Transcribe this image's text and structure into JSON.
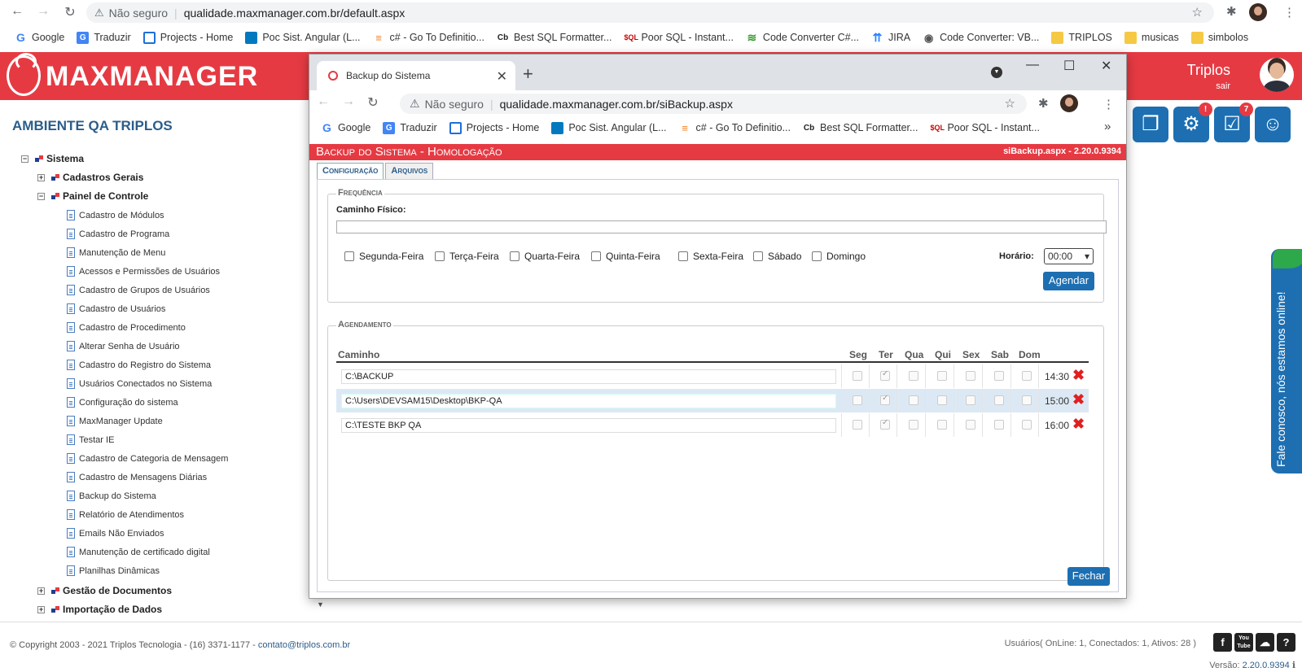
{
  "outer_browser": {
    "security_label": "Não seguro",
    "url": "qualidade.maxmanager.com.br/default.aspx",
    "bookmarks": [
      {
        "label": "Google",
        "icon": "google-icon"
      },
      {
        "label": "Traduzir",
        "icon": "translate-icon"
      },
      {
        "label": "Projects - Home",
        "icon": "projects-icon"
      },
      {
        "label": "Poc Sist. Angular (L...",
        "icon": "trello-icon"
      },
      {
        "label": "c# - Go To Definitio...",
        "icon": "stackoverflow-icon"
      },
      {
        "label": "Best SQL Formatter...",
        "icon": "cb-icon"
      },
      {
        "label": "Poor SQL - Instant...",
        "icon": "sql-icon"
      },
      {
        "label": "Code Converter C#...",
        "icon": "code-converter-icon"
      },
      {
        "label": "JIRA",
        "icon": "jira-icon"
      },
      {
        "label": "Code Converter: VB...",
        "icon": "globe-icon"
      },
      {
        "label": "TRIPLOS",
        "icon": "folder-icon"
      },
      {
        "label": "musicas",
        "icon": "folder-icon"
      },
      {
        "label": "simbolos",
        "icon": "folder-icon"
      }
    ]
  },
  "app": {
    "logo_text": "MAXMANAGER",
    "user_name": "Triplos",
    "logout": "sair",
    "environment": "AMBIENTE QA TRIPLOS",
    "badges": {
      "settings": "!",
      "tasks": "7"
    }
  },
  "tree": {
    "root": "Sistema",
    "groups": [
      {
        "label": "Cadastros Gerais",
        "expanded": false
      },
      {
        "label": "Painel de Controle",
        "expanded": true
      }
    ],
    "items": [
      "Cadastro de Módulos",
      "Cadastro de Programa",
      "Manutenção de Menu",
      "Acessos e Permissões de Usuários",
      "Cadastro de Grupos de Usuários",
      "Cadastro de Usuários",
      "Cadastro de Procedimento",
      "Alterar Senha de Usuário",
      "Cadastro do Registro do Sistema",
      "Usuários Conectados no Sistema",
      "Configuração do sistema",
      "MaxManager Update",
      "Testar IE",
      "Cadastro de Categoria de Mensagem",
      "Cadastro de Mensagens Diárias",
      "Backup do Sistema",
      "Relatório de Atendimentos",
      "Emails Não Enviados",
      "Manutenção de certificado digital",
      "Planilhas Dinâmicas"
    ],
    "after_groups": [
      "Gestão de Documentos",
      "Importação de Dados"
    ]
  },
  "footer": {
    "copyright": "© Copyright 2003 - 2021 Triplos Tecnologia - (16) 3371-1177 - ",
    "email": "contato@triplos.com.br",
    "users": "Usuários( OnLine: 1, Conectados: 1, Ativos: 28 )",
    "version_label": "Versão: ",
    "version": "2.20.0.9394",
    "social": [
      "f",
      "You Tube",
      "☁",
      "?"
    ]
  },
  "chat_tab": "Fale conosco, nós estamos online!",
  "popup": {
    "tab_title": "Backup do Sistema",
    "security_label": "Não seguro",
    "url": "qualidade.maxmanager.com.br/siBackup.aspx",
    "bookmarks": [
      {
        "label": "Google",
        "icon": "google-icon"
      },
      {
        "label": "Traduzir",
        "icon": "translate-icon"
      },
      {
        "label": "Projects - Home",
        "icon": "projects-icon"
      },
      {
        "label": "Poc Sist. Angular (L...",
        "icon": "trello-icon"
      },
      {
        "label": "c# - Go To Definitio...",
        "icon": "stackoverflow-icon"
      },
      {
        "label": "Best SQL Formatter...",
        "icon": "cb-icon"
      },
      {
        "label": "Poor SQL - Instant...",
        "icon": "sql-icon"
      }
    ],
    "more_bookmarks": "»",
    "page_title": "Backup do Sistema  - Homologação",
    "page_version": "siBackup.aspx - 2.20.0.9394",
    "tabs": [
      "Configuração",
      "Arquivos"
    ],
    "frequencia": {
      "legend": "Frequência",
      "path_label": "Caminho Físico:",
      "path_value": "",
      "days": [
        "Segunda-Feira",
        "Terça-Feira",
        "Quarta-Feira",
        "Quinta-Feira",
        "Sexta-Feira",
        "Sábado",
        "Domingo"
      ],
      "time_label": "Horário:",
      "time_value": "00:00",
      "schedule_button": "Agendar"
    },
    "agendamento": {
      "legend": "Agendamento",
      "columns": [
        "Caminho",
        "Seg",
        "Ter",
        "Qua",
        "Qui",
        "Sex",
        "Sab",
        "Dom"
      ],
      "rows": [
        {
          "path": "C:\\BACKUP",
          "days": [
            false,
            true,
            false,
            false,
            false,
            false,
            false
          ],
          "time": "14:30"
        },
        {
          "path": "C:\\Users\\DEVSAM15\\Desktop\\BKP-QA",
          "days": [
            false,
            true,
            false,
            false,
            false,
            false,
            false
          ],
          "time": "15:00"
        },
        {
          "path": "C:\\TESTE BKP QA",
          "days": [
            false,
            true,
            false,
            false,
            false,
            false,
            false
          ],
          "time": "16:00"
        }
      ]
    },
    "close_button": "Fechar"
  }
}
